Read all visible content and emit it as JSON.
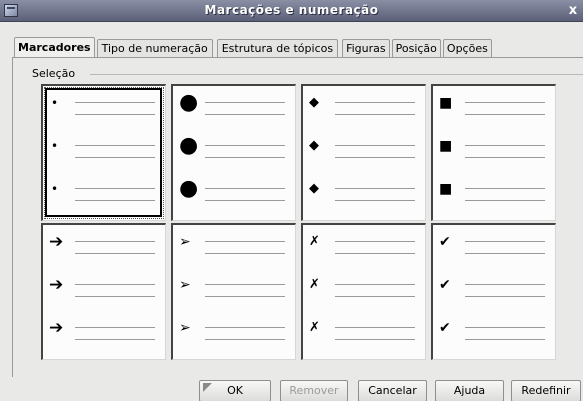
{
  "window": {
    "title": "Marcações e numeração",
    "close_glyph": "x"
  },
  "tabs": [
    {
      "label": "Marcadores",
      "active": true
    },
    {
      "label": "Tipo de numeração",
      "active": false
    },
    {
      "label": "Estrutura de tópicos",
      "active": false
    },
    {
      "label": "Figuras",
      "active": false
    },
    {
      "label": "Posição",
      "active": false
    },
    {
      "label": "Opções",
      "active": false
    }
  ],
  "section": {
    "label": "Seleção"
  },
  "bullet_styles": [
    {
      "name": "small-bullet",
      "glyph": "•",
      "selected": true
    },
    {
      "name": "large-bullet",
      "glyph": "●",
      "selected": false
    },
    {
      "name": "diamond",
      "glyph": "◆",
      "selected": false
    },
    {
      "name": "square",
      "glyph": "■",
      "selected": false
    },
    {
      "name": "bold-arrow",
      "glyph": "➔",
      "selected": false
    },
    {
      "name": "outline-arrow",
      "glyph": "➢",
      "selected": false
    },
    {
      "name": "x-mark",
      "glyph": "✗",
      "selected": false
    },
    {
      "name": "check-mark",
      "glyph": "✔",
      "selected": false
    }
  ],
  "buttons": {
    "ok": "OK",
    "remove": "Remover",
    "cancel": "Cancelar",
    "help": "Ajuda",
    "reset": "Redefinir"
  }
}
